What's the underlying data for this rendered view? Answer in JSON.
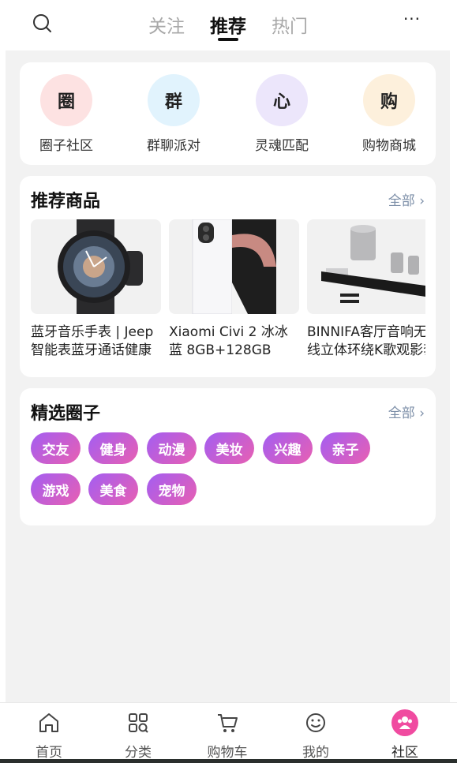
{
  "top_nav": {
    "tabs": [
      {
        "label": "关注"
      },
      {
        "label": "推荐"
      },
      {
        "label": "热门"
      }
    ],
    "active_tab": "推荐",
    "more_label": "···"
  },
  "quick_entries": [
    {
      "char": "圈",
      "label": "圈子社区",
      "color": "#fde2e2"
    },
    {
      "char": "群",
      "label": "群聊派对",
      "color": "#e1f3fd"
    },
    {
      "char": "心",
      "label": "灵魂匹配",
      "color": "#ece6fb"
    },
    {
      "char": "购",
      "label": "购物商城",
      "color": "#fdf0dc"
    }
  ],
  "products_section": {
    "title": "推荐商品",
    "more": "全部 ›",
    "items": [
      {
        "name": "蓝牙音乐手表 | Jeep智能表蓝牙通话健康检测"
      },
      {
        "name": "Xiaomi Civi 2 冰冰蓝 8GB+128GB"
      },
      {
        "name": "BINNIFA客厅音响无线立体环绕K歌观影套装"
      }
    ]
  },
  "circles_section": {
    "title": "精选圈子",
    "more": "全部 ›",
    "tags": [
      "交友",
      "健身",
      "动漫",
      "美妆",
      "兴趣",
      "亲子",
      "游戏",
      "美食",
      "宠物"
    ]
  },
  "bottom_nav": {
    "items": [
      {
        "label": "首页",
        "icon": "home-icon"
      },
      {
        "label": "分类",
        "icon": "category-icon"
      },
      {
        "label": "购物车",
        "icon": "cart-icon"
      },
      {
        "label": "我的",
        "icon": "profile-icon"
      },
      {
        "label": "社区",
        "icon": "community-icon"
      }
    ],
    "active": "社区",
    "active_color": "#f04ba0"
  },
  "tag_gradient": [
    "#a35ef2",
    "#e85fb2"
  ]
}
